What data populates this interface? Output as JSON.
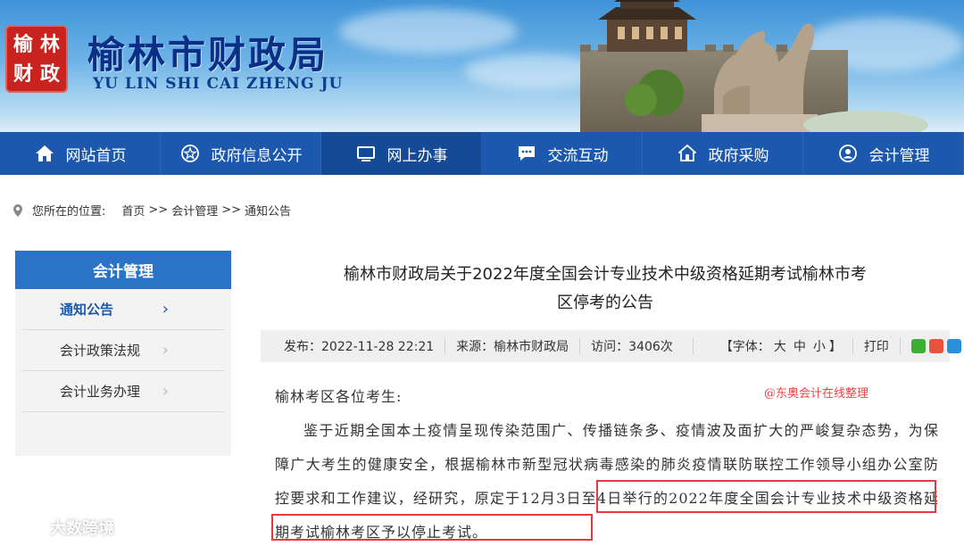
{
  "header": {
    "logo_chars": [
      "榆",
      "林",
      "财",
      "政"
    ],
    "title": "榆林市财政局",
    "subtitle": "YU LIN SHI CAI ZHENG JU"
  },
  "nav": [
    {
      "label": "网站首页",
      "icon": "home-icon"
    },
    {
      "label": "政府信息公开",
      "icon": "emblem-icon"
    },
    {
      "label": "网上办事",
      "icon": "monitor-icon",
      "active": true
    },
    {
      "label": "交流互动",
      "icon": "chat-icon"
    },
    {
      "label": "政府采购",
      "icon": "house-icon"
    },
    {
      "label": "会计管理",
      "icon": "user-icon"
    }
  ],
  "breadcrumb": {
    "label": "您所在的位置:",
    "items": [
      "首页",
      "会计管理",
      "通知公告"
    ],
    "sep": ">>"
  },
  "sidebar": {
    "title": "会计管理",
    "items": [
      {
        "label": "通知公告",
        "active": true
      },
      {
        "label": "会计政策法规"
      },
      {
        "label": "会计业务办理"
      }
    ],
    "chevron": "›"
  },
  "article": {
    "title_line1": "榆林市财政局关于2022年度全国会计专业技术中级资格延期考试榆林市考",
    "title_line2": "区停考的公告",
    "meta": {
      "date": "发布：2022-11-28 22:21",
      "source": "来源：榆林市财政局",
      "visits": "访问：3406次",
      "font_label": "【字体：",
      "font_sizes": [
        "大",
        "中",
        "小"
      ],
      "font_end": "】",
      "print": "打印"
    },
    "greeting": "榆林考区各位考生:",
    "para1_a": "鉴于近期全国本土疫情呈现传染范围广、传播链条多、疫情波及面扩大的严峻复杂态势，为保障广大考生的健康安全，根据榆林市新型冠状病毒感染的肺炎疫情联防联控工作领导小组办公室防控要求和工作建议，经研究，",
    "para1_hl": "原定于12月3日至4日举行的2022年度全国会计专业技术中级资格延期考试榆林考区予以停止考试。",
    "note": "@东奥会计在线整理"
  },
  "watermark": "大数跨境",
  "colors": {
    "nav_bg": "#1c59ae",
    "sidebar_head": "#2a73c7",
    "title_blue": "#0b2f86",
    "highlight_red": "#e23a3f",
    "seal_red": "#c8231f"
  }
}
